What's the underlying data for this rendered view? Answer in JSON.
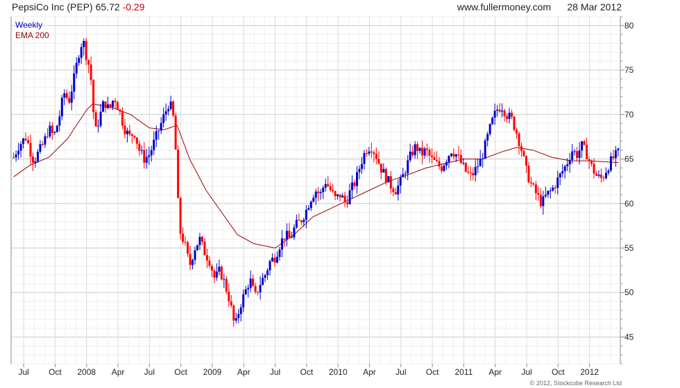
{
  "header": {
    "ticker": "PepsiCo Inc (PEP)",
    "price": "65.72",
    "change": "-0.29",
    "site": "www.fullermoney.com",
    "date": "28 Mar 2012"
  },
  "copyright": "© 2012, Stockcube Research Ltd",
  "colors": {
    "up": "#0000cc",
    "down": "#ff0000",
    "ema": "#990000",
    "grid": "#dddddd"
  },
  "chart_data": {
    "type": "candlestick",
    "legend": [
      {
        "label": "Weekly",
        "color": "#0000cc"
      },
      {
        "label": "EMA 200",
        "color": "#990000"
      }
    ],
    "ylim": [
      42,
      81
    ],
    "y_ticks": [
      45,
      50,
      55,
      60,
      65,
      70,
      75,
      80
    ],
    "x_ticks": [
      "Jul",
      "Oct",
      "2008",
      "Apr",
      "Jul",
      "Oct",
      "2009",
      "Apr",
      "Jul",
      "Oct",
      "2010",
      "Apr",
      "Jul",
      "Oct",
      "2011",
      "Apr",
      "Jul",
      "Oct",
      "2012"
    ],
    "x_tick_positions": [
      0.062,
      0.176,
      0.291,
      0.403,
      0.517,
      0.632,
      0.745,
      0.858,
      0.973,
      1.088,
      1.202,
      1.315,
      1.428,
      1.543,
      1.657,
      1.77,
      1.883,
      1.998,
      2.112
    ],
    "x_range_years": [
      2007.46,
      2008.25
    ],
    "close_points": [
      [
        2007.42,
        65.2
      ],
      [
        2007.46,
        66.5
      ],
      [
        2007.52,
        67.5
      ],
      [
        2007.55,
        66.0
      ],
      [
        2007.58,
        64.8
      ],
      [
        2007.62,
        65.8
      ],
      [
        2007.66,
        66.8
      ],
      [
        2007.7,
        68.5
      ],
      [
        2007.74,
        67.5
      ],
      [
        2007.78,
        69.5
      ],
      [
        2007.82,
        72.5
      ],
      [
        2007.86,
        71.5
      ],
      [
        2007.9,
        74.0
      ],
      [
        2007.94,
        77.0
      ],
      [
        2007.97,
        78.5
      ],
      [
        2008.0,
        76.5
      ],
      [
        2008.03,
        75.0
      ],
      [
        2008.05,
        71.0
      ],
      [
        2008.07,
        68.0
      ],
      [
        2008.1,
        69.5
      ],
      [
        2008.14,
        71.5
      ],
      [
        2008.18,
        70.5
      ],
      [
        2008.22,
        72.0
      ],
      [
        2008.26,
        70.5
      ],
      [
        2008.3,
        68.5
      ],
      [
        2008.34,
        67.5
      ],
      [
        2008.38,
        68.0
      ],
      [
        2008.42,
        66.0
      ],
      [
        2008.46,
        65.0
      ],
      [
        2008.5,
        65.5
      ],
      [
        2008.54,
        67.0
      ],
      [
        2008.58,
        68.5
      ],
      [
        2008.62,
        70.0
      ],
      [
        2008.66,
        71.5
      ],
      [
        2008.7,
        69.0
      ],
      [
        2008.72,
        62.0
      ],
      [
        2008.74,
        57.0
      ],
      [
        2008.78,
        55.5
      ],
      [
        2008.82,
        53.0
      ],
      [
        2008.86,
        55.0
      ],
      [
        2008.9,
        56.0
      ],
      [
        2008.94,
        54.5
      ],
      [
        2008.98,
        53.5
      ],
      [
        2009.02,
        51.5
      ],
      [
        2009.06,
        52.5
      ],
      [
        2009.1,
        51.0
      ],
      [
        2009.14,
        49.0
      ],
      [
        2009.18,
        46.0
      ],
      [
        2009.22,
        48.5
      ],
      [
        2009.26,
        50.0
      ],
      [
        2009.3,
        51.5
      ],
      [
        2009.34,
        49.5
      ],
      [
        2009.38,
        51.0
      ],
      [
        2009.42,
        52.0
      ],
      [
        2009.46,
        53.5
      ],
      [
        2009.5,
        54.0
      ],
      [
        2009.54,
        55.5
      ],
      [
        2009.58,
        56.5
      ],
      [
        2009.62,
        56.0
      ],
      [
        2009.66,
        57.5
      ],
      [
        2009.7,
        58.0
      ],
      [
        2009.74,
        59.0
      ],
      [
        2009.78,
        60.5
      ],
      [
        2009.82,
        61.5
      ],
      [
        2009.86,
        61.0
      ],
      [
        2009.9,
        62.5
      ],
      [
        2009.94,
        61.5
      ],
      [
        2009.98,
        60.5
      ],
      [
        2010.02,
        61.0
      ],
      [
        2010.06,
        60.0
      ],
      [
        2010.1,
        61.5
      ],
      [
        2010.14,
        62.5
      ],
      [
        2010.18,
        64.5
      ],
      [
        2010.22,
        66.0
      ],
      [
        2010.26,
        66.5
      ],
      [
        2010.3,
        65.5
      ],
      [
        2010.34,
        64.0
      ],
      [
        2010.38,
        63.0
      ],
      [
        2010.42,
        62.0
      ],
      [
        2010.46,
        61.5
      ],
      [
        2010.5,
        62.5
      ],
      [
        2010.54,
        64.0
      ],
      [
        2010.58,
        65.5
      ],
      [
        2010.62,
        66.5
      ],
      [
        2010.66,
        65.5
      ],
      [
        2010.7,
        66.0
      ],
      [
        2010.74,
        65.0
      ],
      [
        2010.78,
        64.5
      ],
      [
        2010.82,
        64.0
      ],
      [
        2010.86,
        65.0
      ],
      [
        2010.9,
        66.0
      ],
      [
        2010.94,
        65.5
      ],
      [
        2010.98,
        64.5
      ],
      [
        2011.02,
        63.5
      ],
      [
        2011.06,
        63.0
      ],
      [
        2011.1,
        64.0
      ],
      [
        2011.14,
        65.0
      ],
      [
        2011.18,
        67.0
      ],
      [
        2011.22,
        69.0
      ],
      [
        2011.26,
        70.5
      ],
      [
        2011.3,
        71.0
      ],
      [
        2011.34,
        70.0
      ],
      [
        2011.38,
        69.5
      ],
      [
        2011.42,
        68.0
      ],
      [
        2011.46,
        66.0
      ],
      [
        2011.5,
        63.5
      ],
      [
        2011.54,
        62.0
      ],
      [
        2011.58,
        61.0
      ],
      [
        2011.62,
        60.0
      ],
      [
        2011.66,
        61.0
      ],
      [
        2011.7,
        61.5
      ],
      [
        2011.74,
        62.5
      ],
      [
        2011.78,
        63.5
      ],
      [
        2011.82,
        64.5
      ],
      [
        2011.86,
        66.0
      ],
      [
        2011.9,
        65.5
      ],
      [
        2011.94,
        66.5
      ],
      [
        2011.98,
        65.5
      ],
      [
        2012.02,
        64.0
      ],
      [
        2012.06,
        63.0
      ],
      [
        2012.1,
        62.8
      ],
      [
        2012.14,
        64.0
      ],
      [
        2012.18,
        65.0
      ],
      [
        2012.23,
        65.7
      ]
    ],
    "ema_points": [
      [
        2007.42,
        63.0
      ],
      [
        2007.55,
        64.3
      ],
      [
        2007.7,
        65.2
      ],
      [
        2007.85,
        67.3
      ],
      [
        2008.0,
        70.5
      ],
      [
        2008.05,
        71.2
      ],
      [
        2008.2,
        70.8
      ],
      [
        2008.35,
        70.0
      ],
      [
        2008.5,
        68.5
      ],
      [
        2008.62,
        68.3
      ],
      [
        2008.72,
        68.8
      ],
      [
        2008.82,
        65.0
      ],
      [
        2008.95,
        61.5
      ],
      [
        2009.1,
        58.5
      ],
      [
        2009.2,
        56.5
      ],
      [
        2009.33,
        55.5
      ],
      [
        2009.5,
        55.0
      ],
      [
        2009.65,
        56.5
      ],
      [
        2009.8,
        58.5
      ],
      [
        2009.95,
        59.5
      ],
      [
        2010.1,
        60.5
      ],
      [
        2010.25,
        61.5
      ],
      [
        2010.4,
        62.5
      ],
      [
        2010.55,
        63.2
      ],
      [
        2010.7,
        64.0
      ],
      [
        2010.85,
        64.5
      ],
      [
        2011.0,
        65.0
      ],
      [
        2011.15,
        65.0
      ],
      [
        2011.3,
        65.8
      ],
      [
        2011.42,
        66.3
      ],
      [
        2011.55,
        66.0
      ],
      [
        2011.7,
        65.2
      ],
      [
        2011.85,
        64.8
      ],
      [
        2012.0,
        64.8
      ],
      [
        2012.23,
        64.6
      ]
    ]
  }
}
